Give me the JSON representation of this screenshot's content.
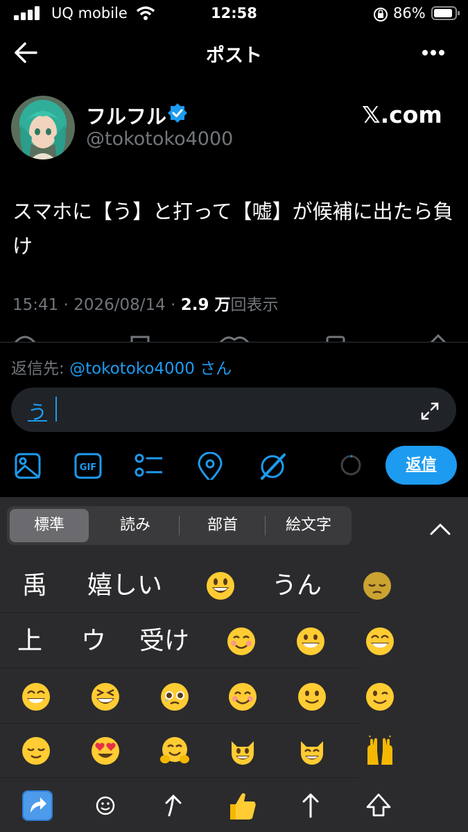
{
  "status_bar": {
    "carrier": "UQ mobile",
    "time": "12:58",
    "battery": "86%"
  },
  "header": {
    "title": "ポスト"
  },
  "post": {
    "author_name": "フルフル",
    "handle": "@tokotoko4000",
    "source_logo": "𝕏.com",
    "text": "スマホに【う】と打って【嘘】が候補に出たら負け",
    "timestamp": "15:41 · 2026/08/14 · ",
    "views_count": "2.9 万",
    "views_label": "回表示"
  },
  "reply": {
    "reply_to_label": "返信先: ",
    "reply_to_handle": "@tokotoko4000 さん",
    "input_value": "う",
    "send_label": "返信"
  },
  "keyboard": {
    "tabs": [
      "標準",
      "読み",
      "部首",
      "絵文字"
    ],
    "candidates_row1": [
      "禹",
      "嬉しい",
      "うん"
    ],
    "candidates_row2": [
      "上",
      "ウ",
      "受け"
    ]
  },
  "colors": {
    "accent": "#1d9bf0",
    "background": "#000000",
    "keyboard": "#2b2b2d"
  }
}
